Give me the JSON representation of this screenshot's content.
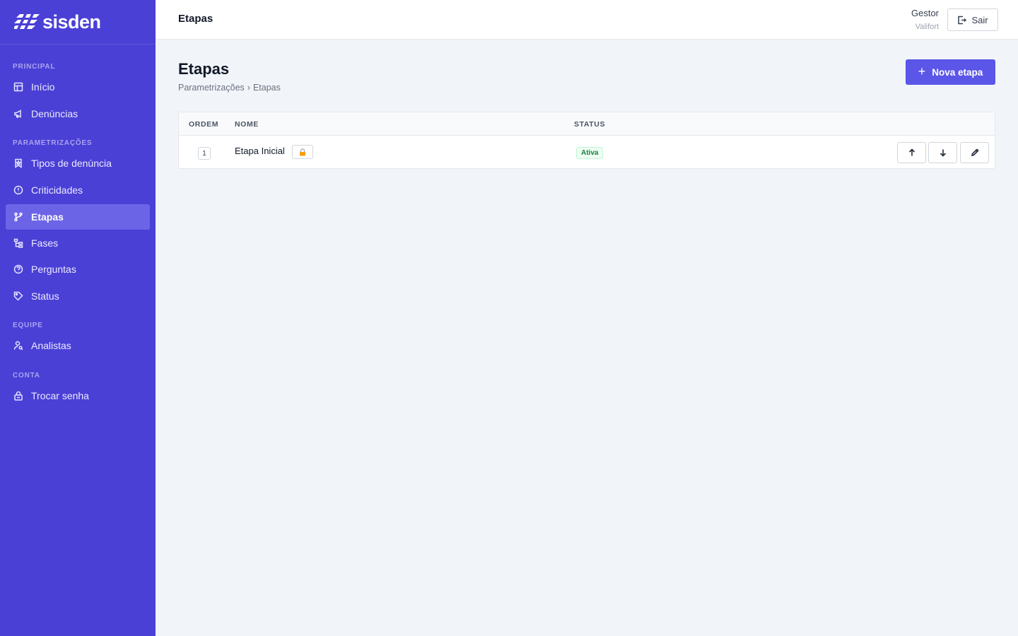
{
  "brand": {
    "name": "sisden"
  },
  "sidebar": {
    "sections": [
      {
        "title": "PRINCIPAL"
      },
      {
        "title": "PARAMETRIZAÇÕES"
      },
      {
        "title": "EQUIPE"
      },
      {
        "title": "CONTA"
      }
    ],
    "items": [
      {
        "label": "Início",
        "icon": "layout-icon"
      },
      {
        "label": "Denúncias",
        "icon": "megaphone-icon"
      },
      {
        "label": "Tipos de denúncia",
        "icon": "bookmark-icon"
      },
      {
        "label": "Criticidades",
        "icon": "alert-circle-icon"
      },
      {
        "label": "Etapas",
        "icon": "git-branch-icon",
        "active": true
      },
      {
        "label": "Fases",
        "icon": "tree-icon"
      },
      {
        "label": "Perguntas",
        "icon": "help-circle-icon"
      },
      {
        "label": "Status",
        "icon": "tag-icon"
      },
      {
        "label": "Analistas",
        "icon": "user-search-icon"
      },
      {
        "label": "Trocar senha",
        "icon": "lock-icon"
      }
    ]
  },
  "topbar": {
    "title": "Etapas",
    "user_name": "Gestor",
    "user_org": "Valifort",
    "logout_label": "Sair"
  },
  "main": {
    "title": "Etapas",
    "breadcrumb": [
      "Parametrizações",
      "Etapas"
    ],
    "breadcrumb_sep": "›",
    "new_button_label": "Nova etapa"
  },
  "table": {
    "columns": [
      "ORDEM",
      "NOME",
      "STATUS"
    ],
    "rows": [
      {
        "order": "1",
        "name": "Etapa Inicial",
        "locked": true,
        "status": "Ativa"
      }
    ]
  },
  "colors": {
    "sidebar_bg": "#4a40d6",
    "sidebar_active": "#6c64e6",
    "primary_button": "#5b55e8",
    "status_active": "#15803d"
  }
}
